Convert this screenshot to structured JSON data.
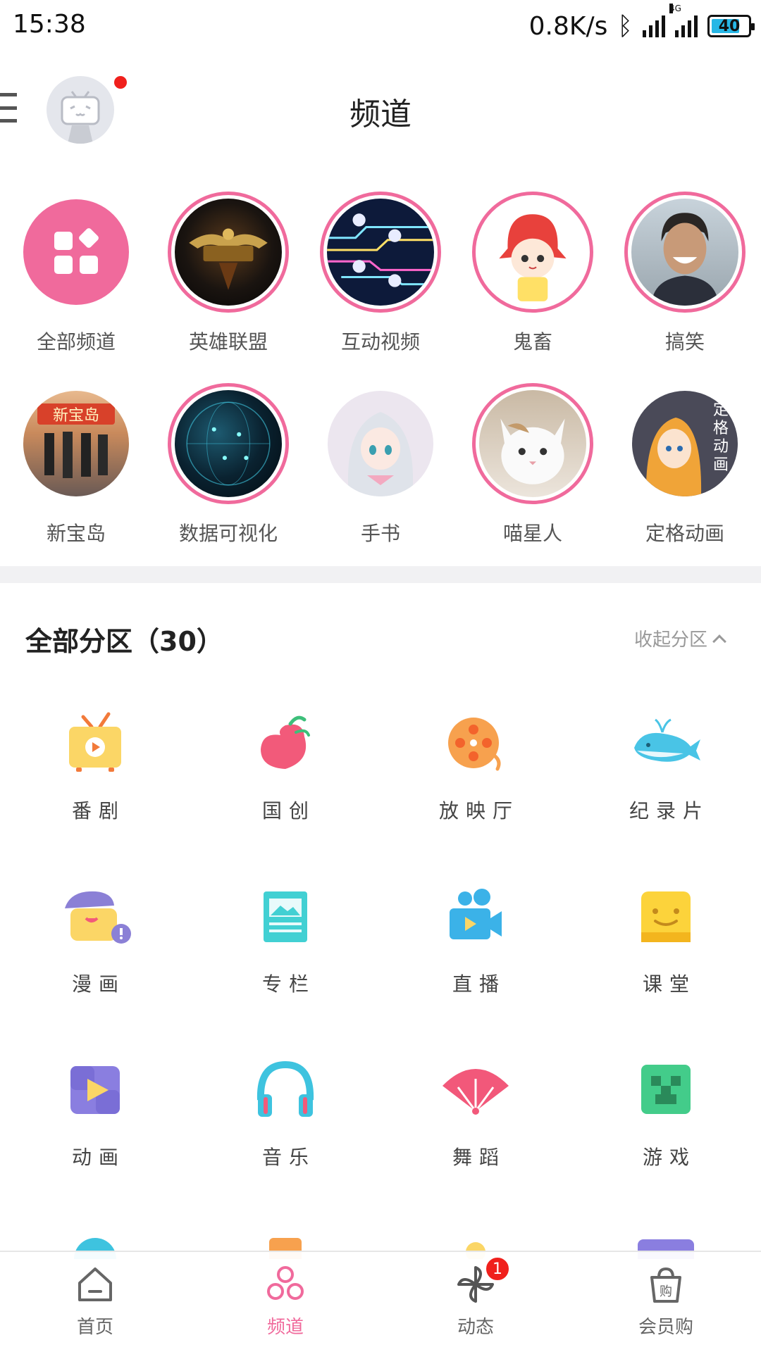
{
  "status_bar": {
    "time": "15:38",
    "net_speed": "0.8K/s",
    "signal_tag": "4G",
    "battery": "40"
  },
  "header": {
    "title": "频道"
  },
  "channels": [
    {
      "label": "全部频道"
    },
    {
      "label": "英雄联盟"
    },
    {
      "label": "互动视频"
    },
    {
      "label": "鬼畜"
    },
    {
      "label": "搞笑"
    },
    {
      "label": "新宝岛"
    },
    {
      "label": "数据可视化"
    },
    {
      "label": "手书"
    },
    {
      "label": "喵星人"
    },
    {
      "label": "定格动画"
    }
  ],
  "sections": {
    "title": "全部分区（30）",
    "collapse_label": "收起分区",
    "items": [
      {
        "label": "番剧",
        "icon": "tv-icon"
      },
      {
        "label": "国创",
        "icon": "peach-icon"
      },
      {
        "label": "放映厅",
        "icon": "film-reel-icon"
      },
      {
        "label": "纪录片",
        "icon": "whale-icon"
      },
      {
        "label": "漫画",
        "icon": "painter-icon"
      },
      {
        "label": "专栏",
        "icon": "article-icon"
      },
      {
        "label": "直播",
        "icon": "camera-icon"
      },
      {
        "label": "课堂",
        "icon": "classroom-icon"
      },
      {
        "label": "动画",
        "icon": "puzzle-play-icon"
      },
      {
        "label": "音乐",
        "icon": "headphones-icon"
      },
      {
        "label": "舞蹈",
        "icon": "fan-icon"
      },
      {
        "label": "游戏",
        "icon": "creeper-icon"
      }
    ]
  },
  "bottom_nav": [
    {
      "label": "首页",
      "icon": "home-icon"
    },
    {
      "label": "频道",
      "icon": "channel-icon",
      "active": true
    },
    {
      "label": "动态",
      "icon": "pinwheel-icon",
      "badge": "1"
    },
    {
      "label": "会员购",
      "icon": "shopping-bag-icon"
    }
  ],
  "colors": {
    "accent": "#f06a9c",
    "badge": "#f0201c"
  }
}
